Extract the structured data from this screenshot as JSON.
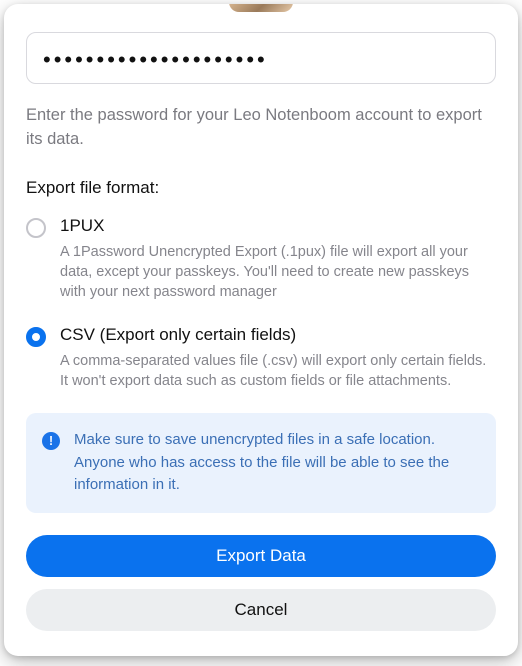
{
  "password_dots": "•••••••••••••••••••••",
  "help_text": "Enter the password for your Leo Notenboom account to export its data.",
  "section_label": "Export file format:",
  "options": [
    {
      "title": "1PUX",
      "desc": "A 1Password Unencrypted Export (.1pux) file will export all your data, except your passkeys. You'll need to create new passkeys with your next password manager",
      "selected": false
    },
    {
      "title": "CSV (Export only certain fields)",
      "desc": "A comma-separated values file (.csv) will export only certain fields. It won't export data such as custom fields or file attachments.",
      "selected": true
    }
  ],
  "notice": "Make sure to save unencrypted files in a safe location. Anyone who has access to the file will be able to see the information in it.",
  "buttons": {
    "primary": "Export Data",
    "secondary": "Cancel"
  }
}
